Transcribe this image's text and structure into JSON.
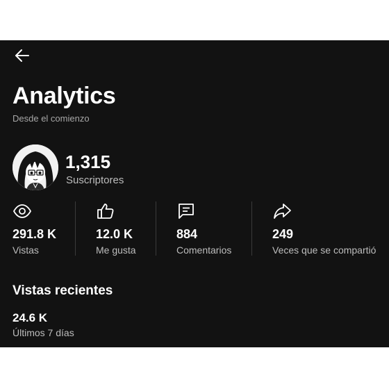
{
  "header": {
    "back_icon": "arrow-left-icon",
    "title": "Analytics",
    "subtitle": "Desde el comienzo"
  },
  "channel": {
    "subscribers_count": "1,315",
    "subscribers_label": "Suscriptores"
  },
  "stats": [
    {
      "icon": "eye-icon",
      "value": "291.8 K",
      "label": "Vistas"
    },
    {
      "icon": "thumbs-up-icon",
      "value": "12.0 K",
      "label": "Me gusta"
    },
    {
      "icon": "comment-icon",
      "value": "884",
      "label": "Comentarios"
    },
    {
      "icon": "share-icon",
      "value": "249",
      "label": "Veces que se compartió"
    }
  ],
  "recent": {
    "title": "Vistas recientes",
    "value": "24.6 K",
    "label": "Últimos 7 días"
  },
  "colors": {
    "background": "#121212",
    "primary_text": "#ffffff",
    "secondary_text": "#bdbdbd"
  }
}
